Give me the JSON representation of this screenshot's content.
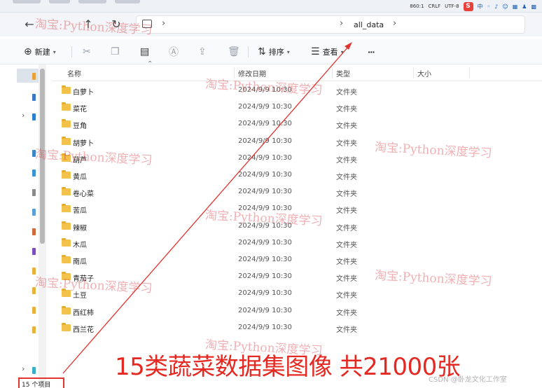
{
  "tray": {
    "indicators": [
      "860:1",
      "CRLF",
      "UTF-8"
    ],
    "ime_logo": "S",
    "ime_mode": "中"
  },
  "address": {
    "crumb": "all_data"
  },
  "toolbar": {
    "new_label": "新建",
    "sort_label": "排序",
    "view_label": "查看",
    "more_label": "···"
  },
  "columns": {
    "name": "名称",
    "modified": "修改日期",
    "type": "类型",
    "size": "大小"
  },
  "files": [
    {
      "name": "白萝卜",
      "modified": "2024/9/9 10:30",
      "type": "文件夹"
    },
    {
      "name": "菜花",
      "modified": "2024/9/9 10:30",
      "type": "文件夹"
    },
    {
      "name": "豆角",
      "modified": "2024/9/9 10:30",
      "type": "文件夹"
    },
    {
      "name": "胡萝卜",
      "modified": "2024/9/9 10:30",
      "type": "文件夹"
    },
    {
      "name": "葫芦",
      "modified": "2024/9/9 10:30",
      "type": "文件夹"
    },
    {
      "name": "黄瓜",
      "modified": "2024/9/9 10:30",
      "type": "文件夹"
    },
    {
      "name": "卷心菜",
      "modified": "2024/9/9 10:30",
      "type": "文件夹"
    },
    {
      "name": "苦瓜",
      "modified": "2024/9/9 10:30",
      "type": "文件夹"
    },
    {
      "name": "辣椒",
      "modified": "2024/9/9 10:30",
      "type": "文件夹"
    },
    {
      "name": "木瓜",
      "modified": "2024/9/9 10:30",
      "type": "文件夹"
    },
    {
      "name": "南瓜",
      "modified": "2024/9/9 10:30",
      "type": "文件夹"
    },
    {
      "name": "青茄子",
      "modified": "2024/9/9 10:30",
      "type": "文件夹"
    },
    {
      "name": "土豆",
      "modified": "2024/9/9 10:30",
      "type": "文件夹"
    },
    {
      "name": "西红柿",
      "modified": "2024/9/9 10:30",
      "type": "文件夹"
    },
    {
      "name": "西兰花",
      "modified": "2024/9/9 10:30",
      "type": "文件夹"
    }
  ],
  "status": {
    "count": "15 个项目"
  },
  "overlay": {
    "watermark": "淘宝:Python深度学习",
    "caption": "15类蔬菜数据集图像 共21000张",
    "credit": "CSDN @卧龙文化工作室",
    "accent": "#e52822"
  },
  "icons": {
    "back": "arrow-left-icon",
    "up": "arrow-up-icon",
    "refresh": "refresh-icon",
    "pc": "monitor-icon",
    "new": "plus-circle-icon",
    "cut": "scissors-icon",
    "copy": "copy-icon",
    "paste": "clipboard-icon",
    "rename": "rename-icon",
    "share": "share-icon",
    "delete": "trash-icon",
    "sort": "sort-icon",
    "view": "view-lines-icon",
    "folder": "folder-icon"
  }
}
